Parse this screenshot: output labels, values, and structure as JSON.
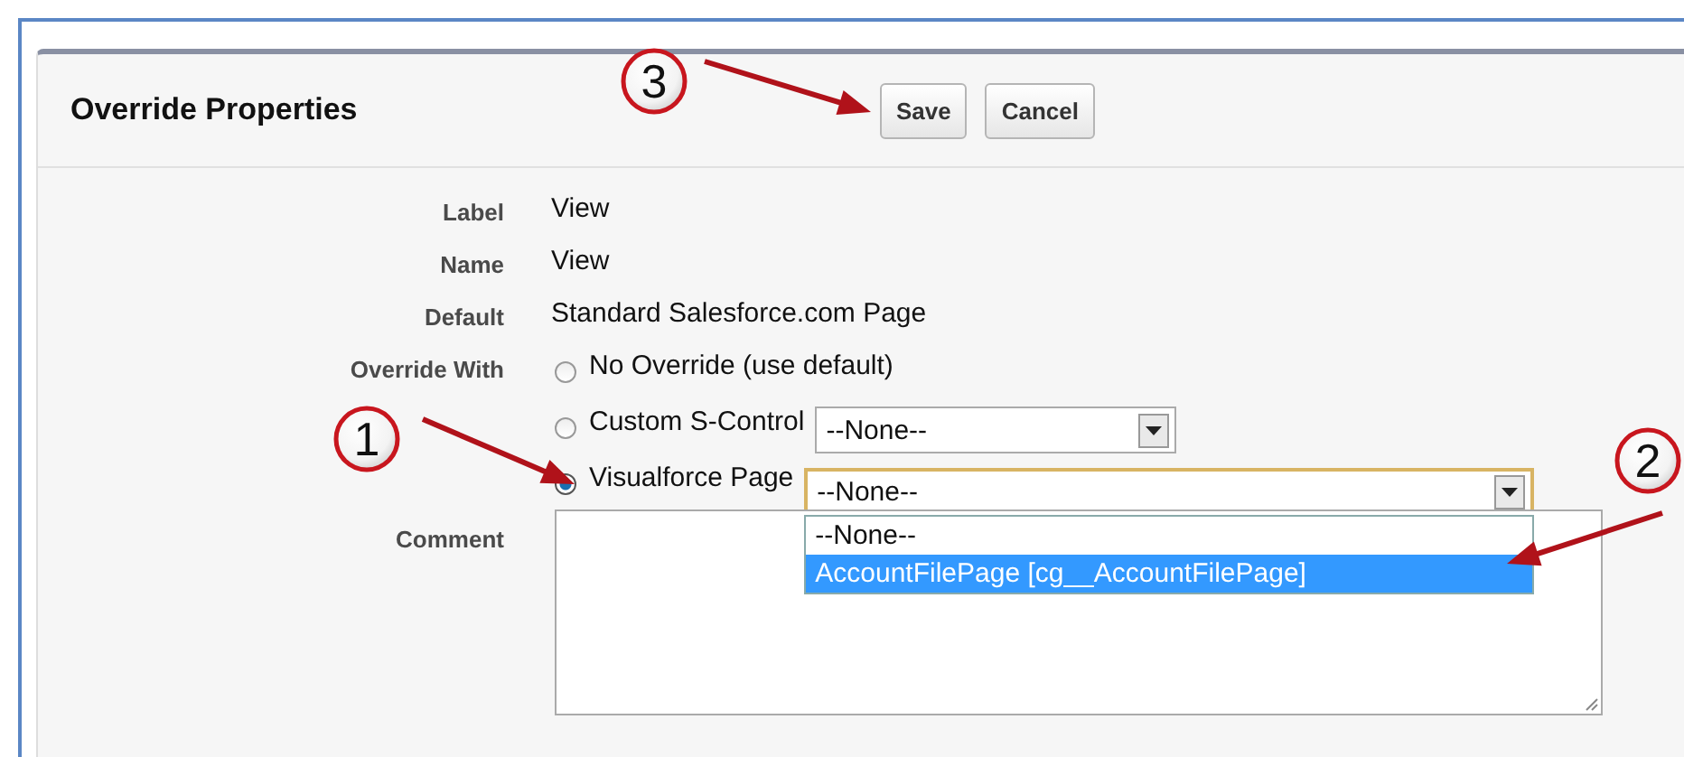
{
  "panel": {
    "title": "Override Properties",
    "buttons": [
      "Save",
      "Cancel"
    ]
  },
  "fields": [
    {
      "label": "Label",
      "value": "View"
    },
    {
      "label": "Name",
      "value": "View"
    },
    {
      "label": "Default",
      "value": "Standard Salesforce.com Page"
    }
  ],
  "override": {
    "label": "Override With",
    "options": [
      {
        "label": "No Override (use default)",
        "selected": false,
        "kind": "plain"
      },
      {
        "label": "Custom S-Control",
        "selected": false,
        "kind": "select",
        "value": "--None--"
      },
      {
        "label": "Visualforce Page",
        "selected": true,
        "kind": "select",
        "value": "--None--",
        "expanded": true,
        "list": [
          {
            "label": "--None--",
            "highlighted": false
          },
          {
            "label": "AccountFilePage [cg__AccountFilePage]",
            "highlighted": true
          }
        ]
      }
    ]
  },
  "comment": {
    "label": "Comment"
  },
  "annotations": [
    {
      "number": "3"
    },
    {
      "number": "1"
    },
    {
      "number": "2"
    }
  ]
}
